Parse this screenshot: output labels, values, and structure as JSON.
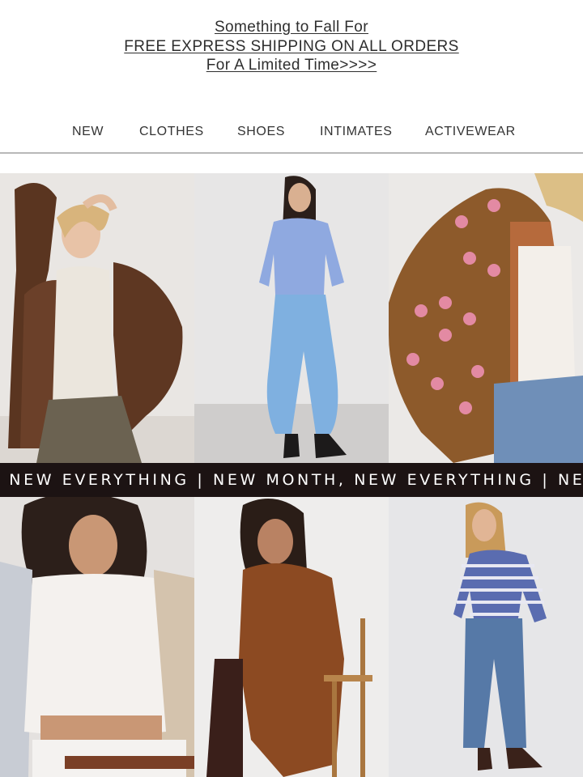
{
  "promo": {
    "line1": "Something to Fall For",
    "line2": "FREE EXPRESS SHIPPING ON ALL ORDERS",
    "line3": "For A Limited Time>>>>"
  },
  "nav": {
    "items": [
      {
        "label": "NEW"
      },
      {
        "label": "CLOTHES"
      },
      {
        "label": "SHOES"
      },
      {
        "label": "INTIMATES"
      },
      {
        "label": "ACTIVEWEAR"
      }
    ]
  },
  "ticker": {
    "text": ", NEW EVERYTHING | NEW MONTH, NEW EVERYTHING | NE"
  },
  "products": [
    {
      "image": "faux-fur-coat-photo"
    },
    {
      "image": "blue-sweater-cargo-pants-photo"
    },
    {
      "image": "floral-knit-cardigan-photo"
    },
    {
      "image": "lace-tank-photo"
    },
    {
      "image": "rust-ruffle-dress-photo"
    },
    {
      "image": "striped-top-jeans-photo"
    }
  ],
  "colors": {
    "ticker_bg": "#1c1313",
    "ticker_text": "#ffffff",
    "link_text": "#2e2e2e",
    "divider": "#b8b8b8"
  }
}
